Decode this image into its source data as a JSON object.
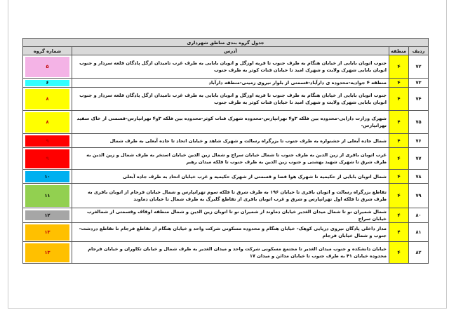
{
  "table": {
    "title": "جدول گروه بندی مناطق شهرداری",
    "headers": {
      "row": "ردیف",
      "zone": "منطقه",
      "address": "آدرس",
      "group": "شماره گروه"
    },
    "rows": [
      {
        "row": "۷۲",
        "zone": "۴",
        "address": "جنوب اتوبان بابایی از خیابان هنگام به طرف جنوب تا قریه اوزگل و اتوبان بابایی به طرف غرب تامیدان ازگل پادگان قلعه سردار و جنوب اتوبان بابایی شهرک ولایت و شهرک امید تا خیابان قنات کوثر به طرف جنوب",
        "group": "۵",
        "color": "#f4b3e6",
        "text_color": "#c00000"
      },
      {
        "row": "۷۳",
        "zone": "۴",
        "address": "منطقه ۴ جوادیه-محدوده ی دارآباد-قسمتی از بلوار نیروی زمینی-منطقه دارآباد",
        "group": "۶",
        "color": "#33ffff",
        "text_color": "#000000"
      },
      {
        "row": "۷۴",
        "zone": "۴",
        "address": "جنوب اتوبان بابایی از خیابان هنگام به طرف جنوب تا قریه اوزگل و اتوبان بابایی به طرف غرب تامیدان ازگل پادگان قلعه سردار و جنوب اتوبان بابایی شهرک ولایت و شهرک امید تا خیابان قنات کوثر به طرف جنوب",
        "group": "۸",
        "color": "#ffff00",
        "text_color": "#c00000"
      },
      {
        "row": "۷۵",
        "zone": "۴",
        "address": "شهرک وزارت دارایی-محدوده بین فلکه ۳و۴ تهرانپارس-محدوده شهرک قنات کوثر-محدوده بین فلکه ۳و۴ تهرانپارس-قسمتی از خاک سفید تهرانپارس-",
        "group": "۸",
        "color": "#ffff00",
        "text_color": "#c00000"
      },
      {
        "row": "۷۶",
        "zone": "۴",
        "address": "شمال جاده آبعلی از جشنواره به طرف جنوب تا بزرگراه رسالت و شهرک شاهد و خیابان اتحاد تا جاده آبعلی به طرف شمال",
        "group": "۹",
        "color": "#ff0000",
        "text_color": "#c00000"
      },
      {
        "row": "۷۷",
        "zone": "۴",
        "address": "غرب اتوبان باقری از زین الدین به طرف جنوب تا شمال خیابان سراج و شمال زین الدین خیابان استخر به طرف شمال و زین الدین به طرف شرق تا شهرک شهید بهشتی و جنوب زین الدین به طرف جنوب تا فلکه میدان رهبر",
        "group": "۹",
        "color": "#ff0000",
        "text_color": "#c00000"
      },
      {
        "row": "۷۸",
        "zone": "۴",
        "address": "شمال اتوبان بابایی از حکیمیه تا شهرک هوا فضا و قسمتی از شهرک حکیمیه و غرب خیابان اتحاد به طرف جاده آبعلی",
        "group": "۱۰",
        "color": "#00b0f0",
        "text_color": "#000000"
      },
      {
        "row": "۷۹",
        "zone": "۴",
        "address": "تقاطع بزرگراه رسالت و اتوبان باقری تا خیابان ۱۹۶ به طرف شرق تا فلکه سوم تهرانپارس و شمال خیابان فرجام از اتوبان باقری به طرف شرق تا فلکه اول تهرانپارس و شرق و غرب اتوبان باقری از تقاطع گلبرگ به طرف شمال تا خیابان دماوند",
        "group": "۱۱",
        "color": "#92d050",
        "text_color": "#000000"
      },
      {
        "row": "۸۰",
        "zone": "۴",
        "address": "شمال شمیران نو تا شمال میدان الغدیر خیابان دماوند از شمیران نو تا اتوبان زین الدین و شمال منطقه اوقاف وقسمتی از شمالغرب خیابان سراج",
        "group": "۱۲",
        "color": "#a6a6a6",
        "text_color": "#000000"
      },
      {
        "row": "۸۱",
        "zone": "۴",
        "address": "مدار داخلی پادگان نیروی دریایی کوهک- خیابان هنگام و محدوده مسکونی شرکت واحد و خیابان هنگام از تقاطع فرجام تا تقاطع دردشت- جنوب و شمال خیابان فرجام",
        "group": "۱۳",
        "color": "#ffc000",
        "text_color": "#c00000"
      },
      {
        "row": "۸۲",
        "zone": "۴",
        "address": "خیابان دانشکده و جنوب میدان الغدیر تا مجتمع مسکونی شرکت واحد و میدان الغدیر به طرف شمال و خیابان تکاوران و خیابان فرجام محدوده خیابان ۴۱ به طرف جنوب تا خیابان مدائن و میدان ۱۷",
        "group": "۱۳",
        "color": "#ffc000",
        "text_color": "#c00000"
      }
    ]
  }
}
